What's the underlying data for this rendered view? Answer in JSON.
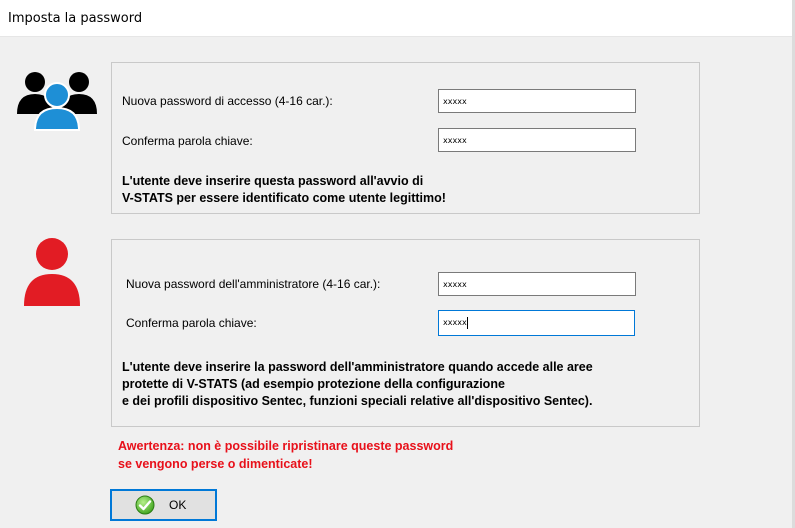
{
  "window": {
    "title": "Imposta la password"
  },
  "user_section": {
    "icon": "users-group-icon",
    "password_label": "Nuova password di accesso (4-16 car.):",
    "password_value": "xxxxx",
    "confirm_label": "Conferma parola chiave:",
    "confirm_value": "xxxxx",
    "note_line1": "L'utente deve inserire questa password all'avvio di",
    "note_line2": "V-STATS per essere identificato come utente legittimo!"
  },
  "admin_section": {
    "icon": "admin-user-icon",
    "password_label": "Nuova password dell'amministratore (4-16 car.):",
    "password_value": "xxxxx",
    "confirm_label": "Conferma parola chiave:",
    "confirm_value": "xxxxx",
    "note_line1": "L'utente deve inserire la password dell'amministratore quando accede alle aree",
    "note_line2": "protette di V-STATS (ad esempio protezione della configurazione",
    "note_line3": "e dei profili dispositivo Sentec, funzioni speciali relative all'dispositivo Sentec)."
  },
  "warning": {
    "line1": "Awertenza: non è possibile ripristinare queste password",
    "line2": "se vengono perse o dimenticate!",
    "color": "#e8101a"
  },
  "ok_button": {
    "label": "OK",
    "icon": "check-circle-icon",
    "focus_color": "#0078d7"
  },
  "colors": {
    "user_icon_blue": "#1e8fd6",
    "admin_icon_red": "#e21c24"
  }
}
